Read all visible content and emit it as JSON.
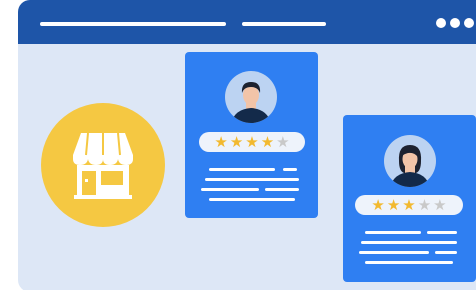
{
  "window": {
    "accent": "#1e55a8",
    "background": "#dde7f6"
  },
  "store": {
    "icon": "storefront-icon",
    "color": "#f5c842"
  },
  "reviews": [
    {
      "rating": 4,
      "max": 5,
      "avatar": "man-avatar-icon"
    },
    {
      "rating": 3,
      "max": 5,
      "avatar": "woman-avatar-icon"
    }
  ],
  "colors": {
    "card": "#2f7ff2",
    "star_on": "#f2b92f",
    "star_off": "#c9c9c9"
  }
}
